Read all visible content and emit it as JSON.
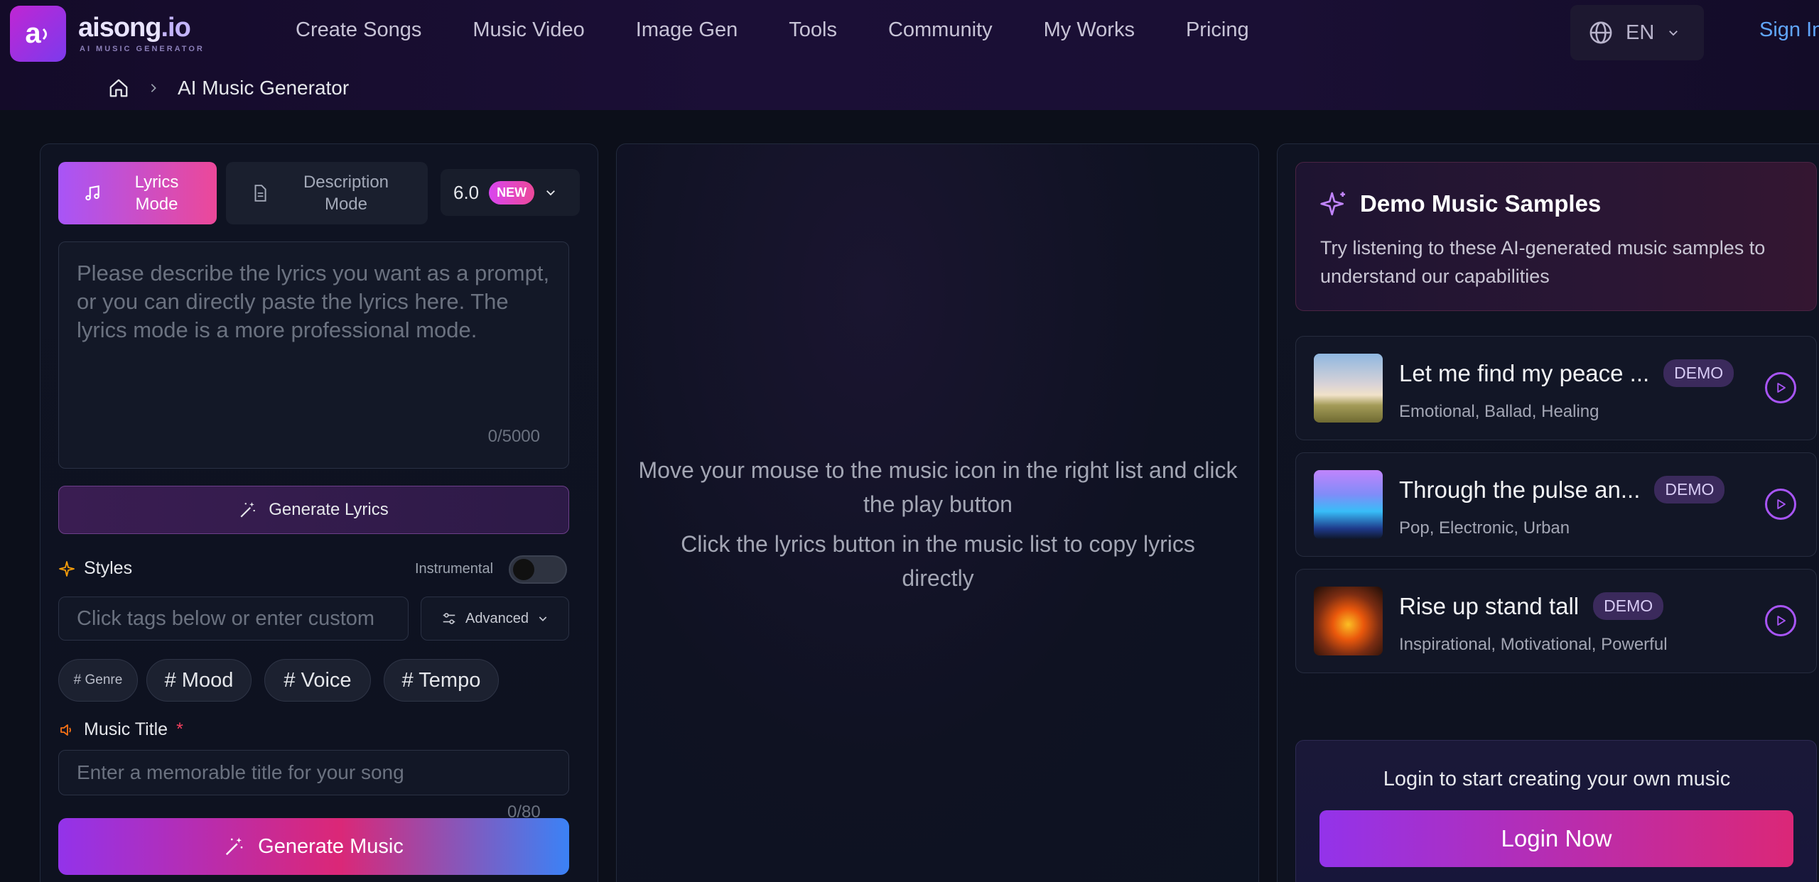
{
  "header": {
    "logo_mark": "a",
    "logo_name": "aisong",
    "logo_tld": ".io",
    "logo_tagline": "AI MUSIC GENERATOR",
    "nav": [
      "Create Songs",
      "Music Video",
      "Image Gen",
      "Tools",
      "Community",
      "My Works",
      "Pricing"
    ],
    "language": "EN",
    "sign_in": "Sign In"
  },
  "breadcrumb": {
    "home_icon": "home-icon",
    "current": "AI Music Generator"
  },
  "composer": {
    "modes": [
      {
        "label": "Lyrics Mode",
        "active": true
      },
      {
        "label": "Description Mode",
        "active": false
      }
    ],
    "version": "6.0",
    "version_badge": "NEW",
    "lyrics_placeholder": "Please describe the lyrics you want as a prompt, or you can directly paste the lyrics here. The lyrics mode is a more professional mode.",
    "lyrics_count": "0/5000",
    "generate_lyrics_label": "Generate Lyrics",
    "styles_label": "Styles",
    "instrumental_label": "Instrumental",
    "instrumental_on": false,
    "tags_placeholder": "Click tags below or enter custom",
    "advanced_label": "Advanced",
    "tag_chips": [
      "# Genre",
      "# Mood",
      "# Voice",
      "# Tempo"
    ],
    "music_title_label": "Music Title",
    "required_mark": "*",
    "title_placeholder": "Enter a memorable title for your song",
    "title_count": "0/80",
    "generate_music_label": "Generate Music"
  },
  "preview": {
    "hint_line_1": "Move your mouse to the music icon in the right list and click the play button",
    "hint_line_2": "Click the lyrics button in the music list to copy lyrics directly"
  },
  "demo": {
    "title": "Demo Music Samples",
    "description": "Try listening to these AI-generated music samples to understand our capabilities",
    "badge": "DEMO",
    "songs": [
      {
        "title": "Let me find my peace ...",
        "tags": "Emotional, Ballad, Healing"
      },
      {
        "title": "Through the pulse an...",
        "tags": "Pop, Electronic, Urban"
      },
      {
        "title": "Rise up stand tall",
        "tags": "Inspirational, Motivational, Powerful"
      }
    ],
    "login_prompt": "Login to start creating your own music",
    "login_button": "Login Now"
  },
  "colors": {
    "accent_purple": "#a855f7",
    "accent_pink": "#ec4899",
    "link_blue": "#60a5fa",
    "background": "#0c0f1a"
  }
}
